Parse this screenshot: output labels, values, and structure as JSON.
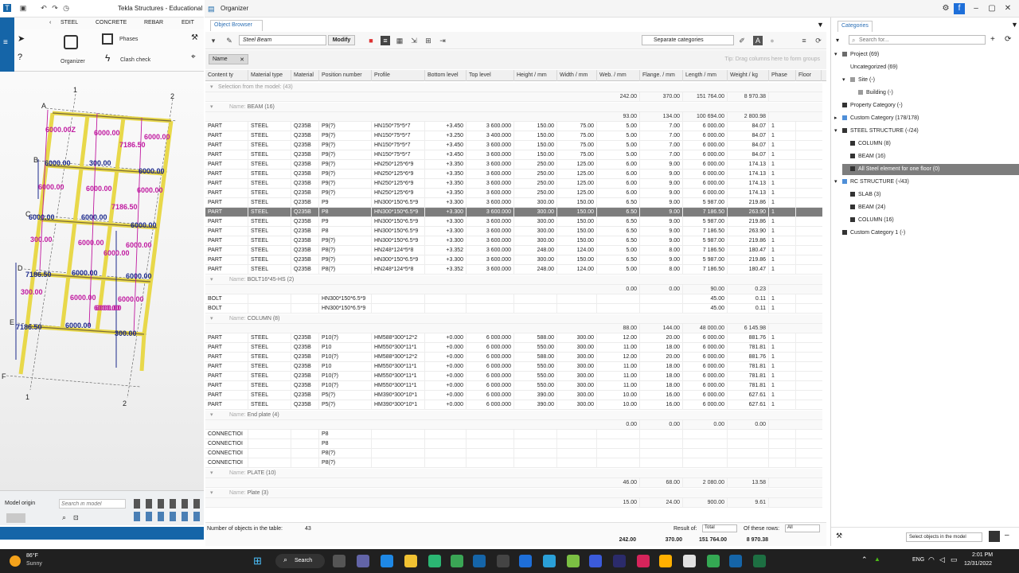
{
  "tekla": {
    "title": "Tekla Structures - Educational",
    "menu": [
      "STEEL",
      "CONCRETE",
      "REBAR",
      "EDIT"
    ],
    "ribbon": {
      "organizer": "Organizer",
      "phases": "Phases",
      "clash_check": "Clash check"
    },
    "bottom": {
      "model_origin": "Model origin",
      "search_placeholder": "Search in model"
    }
  },
  "viewport": {
    "grid_numbers": [
      "1",
      "2",
      "1",
      "2"
    ],
    "grid_letters": [
      "A",
      "B",
      "C",
      "D",
      "E",
      "F"
    ],
    "dims": [
      "6000.00Z",
      "6000.00",
      "6000.00",
      "7186.50",
      "6000.00",
      "300.00",
      "6000.00",
      "6000.00",
      "6000.00",
      "6000.00",
      "6000.00",
      "6000.00",
      "7186.50",
      "6000.00",
      "300.00",
      "6000.00",
      "6000.00",
      "6000.00",
      "7186.50",
      "6000.00",
      "6000.00",
      "300.00",
      "6000.00",
      "6000.00",
      "6000.00",
      "7186.50",
      "6000.00",
      "300.00",
      "6000.00"
    ]
  },
  "organizer": {
    "title": "Organizer",
    "tab": "Object Browser",
    "selection_dropdown": "Steel Beam",
    "modify": "Modify",
    "separate": "Separate categories",
    "group_chip": "Name",
    "group_tip": "Tip: Drag columns here to form groups",
    "columns": [
      "Content ty",
      "Material type",
      "Material",
      "Position number",
      "Profile",
      "Bottom level",
      "Top level",
      "Height / mm",
      "Width / mm",
      "Web. / mm",
      "Flange. / mm",
      "Length / mm",
      "Weight / kg",
      "Phase",
      "Floor"
    ],
    "selection_row": "Selection from the model: (43)",
    "selection_totals": [
      "242.00",
      "370.00",
      "151 764.00",
      "8 970.38"
    ],
    "groups": [
      {
        "label": "Name:",
        "name": "BEAM (16)",
        "totals": [
          "93.00",
          "134.00",
          "100 694.00",
          "2 800.98"
        ],
        "rows": [
          [
            "PART",
            "STEEL",
            "Q235B",
            "P9(?)",
            "HN150*75*5*7",
            "+3.450",
            "3 600.000",
            "150.00",
            "75.00",
            "5.00",
            "7.00",
            "6 000.00",
            "84.07",
            "1"
          ],
          [
            "PART",
            "STEEL",
            "Q235B",
            "P9(?)",
            "HN150*75*5*7",
            "+3.250",
            "3 400.000",
            "150.00",
            "75.00",
            "5.00",
            "7.00",
            "6 000.00",
            "84.07",
            "1"
          ],
          [
            "PART",
            "STEEL",
            "Q235B",
            "P9(?)",
            "HN150*75*5*7",
            "+3.450",
            "3 600.000",
            "150.00",
            "75.00",
            "5.00",
            "7.00",
            "6 000.00",
            "84.07",
            "1"
          ],
          [
            "PART",
            "STEEL",
            "Q235B",
            "P9(?)",
            "HN150*75*5*7",
            "+3.450",
            "3 600.000",
            "150.00",
            "75.00",
            "5.00",
            "7.00",
            "6 000.00",
            "84.07",
            "1"
          ],
          [
            "PART",
            "STEEL",
            "Q235B",
            "P9(?)",
            "HN250*125*6*9",
            "+3.350",
            "3 600.000",
            "250.00",
            "125.00",
            "6.00",
            "9.00",
            "6 000.00",
            "174.13",
            "1"
          ],
          [
            "PART",
            "STEEL",
            "Q235B",
            "P9(?)",
            "HN250*125*6*9",
            "+3.350",
            "3 600.000",
            "250.00",
            "125.00",
            "6.00",
            "9.00",
            "6 000.00",
            "174.13",
            "1"
          ],
          [
            "PART",
            "STEEL",
            "Q235B",
            "P9(?)",
            "HN250*125*6*9",
            "+3.350",
            "3 600.000",
            "250.00",
            "125.00",
            "6.00",
            "9.00",
            "6 000.00",
            "174.13",
            "1"
          ],
          [
            "PART",
            "STEEL",
            "Q235B",
            "P9(?)",
            "HN250*125*6*9",
            "+3.350",
            "3 600.000",
            "250.00",
            "125.00",
            "6.00",
            "9.00",
            "6 000.00",
            "174.13",
            "1"
          ],
          [
            "PART",
            "STEEL",
            "Q235B",
            "P9",
            "HN300*150*6.5*9",
            "+3.300",
            "3 600.000",
            "300.00",
            "150.00",
            "6.50",
            "9.00",
            "5 987.00",
            "219.86",
            "1"
          ],
          [
            "PART",
            "STEEL",
            "Q235B",
            "P8",
            "HN300*150*6.5*9",
            "+3.300",
            "3 600.000",
            "300.00",
            "150.00",
            "6.50",
            "9.00",
            "7 186.50",
            "263.90",
            "1"
          ],
          [
            "PART",
            "STEEL",
            "Q235B",
            "P9",
            "HN300*150*6.5*9",
            "+3.300",
            "3 600.000",
            "300.00",
            "150.00",
            "6.50",
            "9.00",
            "5 987.00",
            "219.86",
            "1"
          ],
          [
            "PART",
            "STEEL",
            "Q235B",
            "P8",
            "HN300*150*6.5*9",
            "+3.300",
            "3 600.000",
            "300.00",
            "150.00",
            "6.50",
            "9.00",
            "7 186.50",
            "263.90",
            "1"
          ],
          [
            "PART",
            "STEEL",
            "Q235B",
            "P9(?)",
            "HN300*150*6.5*9",
            "+3.300",
            "3 600.000",
            "300.00",
            "150.00",
            "6.50",
            "9.00",
            "5 987.00",
            "219.86",
            "1"
          ],
          [
            "PART",
            "STEEL",
            "Q235B",
            "P8(?)",
            "HN248*124*5*8",
            "+3.352",
            "3 600.000",
            "248.00",
            "124.00",
            "5.00",
            "8.00",
            "7 186.50",
            "180.47",
            "1"
          ],
          [
            "PART",
            "STEEL",
            "Q235B",
            "P9(?)",
            "HN300*150*6.5*9",
            "+3.300",
            "3 600.000",
            "300.00",
            "150.00",
            "6.50",
            "9.00",
            "5 987.00",
            "219.86",
            "1"
          ],
          [
            "PART",
            "STEEL",
            "Q235B",
            "P8(?)",
            "HN248*124*5*8",
            "+3.352",
            "3 600.000",
            "248.00",
            "124.00",
            "5.00",
            "8.00",
            "7 186.50",
            "180.47",
            "1"
          ]
        ],
        "selected": 9
      },
      {
        "label": "Name:",
        "name": "BOLT16*45-HS (2)",
        "totals": [
          "0.00",
          "0.00",
          "90.00",
          "0.23"
        ],
        "rows": [
          [
            "BOLT",
            "",
            "",
            "HN300*150*6.5*9",
            "",
            "",
            "",
            "",
            "",
            "",
            "",
            "45.00",
            "0.11",
            "1"
          ],
          [
            "BOLT",
            "",
            "",
            "HN300*150*6.5*9",
            "",
            "",
            "",
            "",
            "",
            "",
            "",
            "45.00",
            "0.11",
            "1"
          ]
        ]
      },
      {
        "label": "Name:",
        "name": "COLUMN (8)",
        "totals": [
          "88.00",
          "144.00",
          "48 000.00",
          "6 145.98"
        ],
        "rows": [
          [
            "PART",
            "STEEL",
            "Q235B",
            "P10(?)",
            "HM588*300*12*2",
            "+0.000",
            "6 000.000",
            "588.00",
            "300.00",
            "12.00",
            "20.00",
            "6 000.00",
            "881.76",
            "1"
          ],
          [
            "PART",
            "STEEL",
            "Q235B",
            "P10",
            "HM550*300*11*1",
            "+0.000",
            "6 000.000",
            "550.00",
            "300.00",
            "11.00",
            "18.00",
            "6 000.00",
            "781.81",
            "1"
          ],
          [
            "PART",
            "STEEL",
            "Q235B",
            "P10(?)",
            "HM588*300*12*2",
            "+0.000",
            "6 000.000",
            "588.00",
            "300.00",
            "12.00",
            "20.00",
            "6 000.00",
            "881.76",
            "1"
          ],
          [
            "PART",
            "STEEL",
            "Q235B",
            "P10",
            "HM550*300*11*1",
            "+0.000",
            "6 000.000",
            "550.00",
            "300.00",
            "11.00",
            "18.00",
            "6 000.00",
            "781.81",
            "1"
          ],
          [
            "PART",
            "STEEL",
            "Q235B",
            "P10(?)",
            "HM550*300*11*1",
            "+0.000",
            "6 000.000",
            "550.00",
            "300.00",
            "11.00",
            "18.00",
            "6 000.00",
            "781.81",
            "1"
          ],
          [
            "PART",
            "STEEL",
            "Q235B",
            "P10(?)",
            "HM550*300*11*1",
            "+0.000",
            "6 000.000",
            "550.00",
            "300.00",
            "11.00",
            "18.00",
            "6 000.00",
            "781.81",
            "1"
          ],
          [
            "PART",
            "STEEL",
            "Q235B",
            "P5(?)",
            "HM390*300*10*1",
            "+0.000",
            "6 000.000",
            "390.00",
            "300.00",
            "10.00",
            "16.00",
            "6 000.00",
            "627.61",
            "1"
          ],
          [
            "PART",
            "STEEL",
            "Q235B",
            "P5(?)",
            "HM390*300*10*1",
            "+0.000",
            "6 000.000",
            "390.00",
            "300.00",
            "10.00",
            "16.00",
            "6 000.00",
            "627.61",
            "1"
          ]
        ]
      },
      {
        "label": "Name:",
        "name": "End plate (4)",
        "totals": [
          "0.00",
          "0.00",
          "0.00",
          "0.00"
        ],
        "rows": [
          [
            "CONNECTIOI",
            "",
            "",
            "P8",
            "",
            "",
            "",
            "",
            "",
            "",
            "",
            "",
            "",
            ""
          ],
          [
            "CONNECTIOI",
            "",
            "",
            "P8",
            "",
            "",
            "",
            "",
            "",
            "",
            "",
            "",
            "",
            ""
          ],
          [
            "CONNECTIOI",
            "",
            "",
            "P8(?)",
            "",
            "",
            "",
            "",
            "",
            "",
            "",
            "",
            "",
            ""
          ],
          [
            "CONNECTIOI",
            "",
            "",
            "P8(?)",
            "",
            "",
            "",
            "",
            "",
            "",
            "",
            "",
            "",
            ""
          ]
        ]
      },
      {
        "label": "Name:",
        "name": "PLATE (10)",
        "totals": [
          "46.00",
          "68.00",
          "2 080.00",
          "13.58"
        ],
        "rows": []
      },
      {
        "label": "Name:",
        "name": "Plate (3)",
        "totals": [
          "15.00",
          "24.00",
          "900.00",
          "9.61"
        ],
        "rows": []
      }
    ],
    "footer": {
      "count_label": "Number of objects in the table:",
      "count": "43",
      "result_of": "Result of:",
      "result_sel": "Total",
      "of_these": "Of these rows:",
      "rows_sel": "All",
      "totals": [
        "242.00",
        "370.00",
        "151 764.00",
        "8 970.38"
      ]
    }
  },
  "categories": {
    "tab": "Categories",
    "search_placeholder": "Search for...",
    "items": [
      {
        "text": "Project (69)",
        "indent": 0,
        "exp": "▾",
        "color": "#6b6b6b"
      },
      {
        "text": "Uncategorized (69)",
        "indent": 1,
        "exp": "",
        "color": ""
      },
      {
        "text": "Site (-)",
        "indent": 1,
        "exp": "▾",
        "color": "#9b9b9b"
      },
      {
        "text": "Building (-)",
        "indent": 2,
        "exp": "",
        "color": "#9b9b9b"
      },
      {
        "text": "Property Category (-)",
        "indent": 0,
        "exp": "",
        "color": "#333333"
      },
      {
        "text": "Custom Category (178/178)",
        "indent": 0,
        "exp": "▸",
        "color": "#4f8fd8"
      },
      {
        "text": "STEEL STRUCTURE (-/24)",
        "indent": 0,
        "exp": "▾",
        "color": "#333333"
      },
      {
        "text": "COLUMN (8)",
        "indent": 1,
        "exp": "",
        "color": "#333333"
      },
      {
        "text": "BEAM (16)",
        "indent": 1,
        "exp": "",
        "color": "#333333"
      },
      {
        "text": "All Steel element for one floor (0)",
        "indent": 1,
        "exp": "",
        "color": "#333333",
        "selected": true
      },
      {
        "text": "RC STRUCTURE (-/43)",
        "indent": 0,
        "exp": "▾",
        "color": "#4f8fd8"
      },
      {
        "text": "SLAB (3)",
        "indent": 1,
        "exp": "",
        "color": "#333333"
      },
      {
        "text": "BEAM (24)",
        "indent": 1,
        "exp": "",
        "color": "#333333"
      },
      {
        "text": "COLUMN (16)",
        "indent": 1,
        "exp": "",
        "color": "#333333"
      },
      {
        "text": "Custom Category 1 (-)",
        "indent": 0,
        "exp": "",
        "color": "#333333"
      }
    ],
    "footer_select": "Select objects in the model"
  },
  "taskbar": {
    "weather_temp": "86°F",
    "weather_text": "Sunny",
    "search": "Search",
    "lang": "ENG",
    "time": "2:01 PM",
    "date": "12/31/2022"
  },
  "colors": {
    "accent": "#1565a8",
    "selected_row": "#7d7d7d",
    "beam_yellow": "#e8d84a",
    "dim_magenta": "#c01aa0",
    "dim_blue": "#1c2a8c"
  }
}
